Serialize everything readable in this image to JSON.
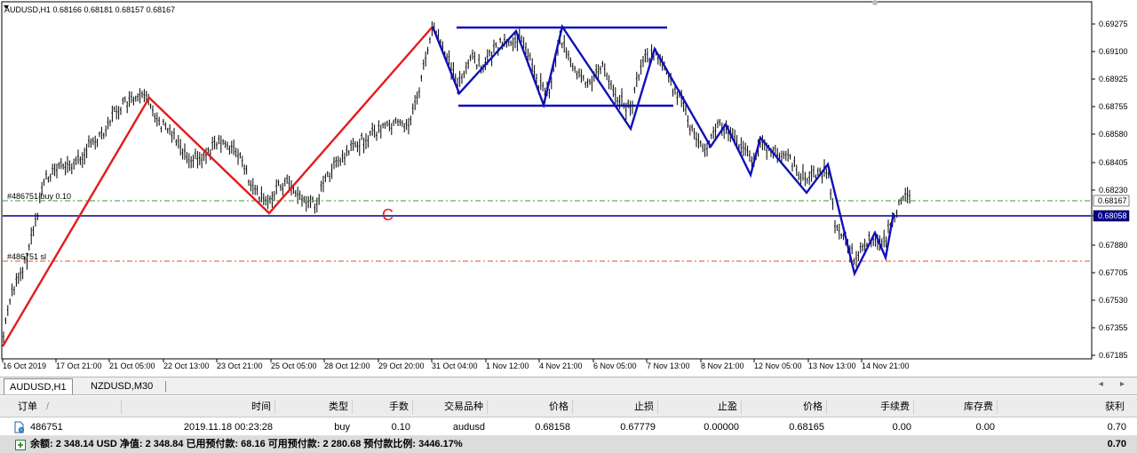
{
  "chart": {
    "symbol_info": "AUDUSD,H1  0.68166 0.68181 0.68157 0.68167",
    "price_axis_labels": [
      "0.69275",
      "0.69100",
      "0.68925",
      "0.68755",
      "0.68580",
      "0.68405",
      "0.68230",
      "0.68058",
      "0.67880",
      "0.67705",
      "0.67530",
      "0.67355",
      "0.67185"
    ],
    "current_price_tag": "0.68167",
    "line_price_tag": "0.68058",
    "time_axis_labels": [
      "16 Oct 2019",
      "17 Oct 21:00",
      "21 Oct 05:00",
      "22 Oct 13:00",
      "23 Oct 21:00",
      "25 Oct 05:00",
      "28 Oct 12:00",
      "29 Oct 20:00",
      "31 Oct 04:00",
      "1 Nov 12:00",
      "4 Nov 21:00",
      "6 Nov 05:00",
      "7 Nov 13:00",
      "8 Nov 21:00",
      "12 Nov 05:00",
      "13 Nov 13:00",
      "14 Nov 21:00"
    ],
    "order_tp_label": "#486751 buy 0.10",
    "order_sl_label": "#486751 sl",
    "annotation_c": "C",
    "colors": {
      "zigzag_red": "#e31b1b",
      "zigzag_blue": "#1010b8",
      "hline": "#00008b",
      "entry_dash": "#3a9a3a",
      "sl_dash": "#e05020",
      "bars": "#000000"
    }
  },
  "tabs": [
    {
      "label": "AUDUSD,H1",
      "active": true
    },
    {
      "label": "NZDUSD,M30",
      "active": false
    }
  ],
  "scroll_arrows": "◂ ▸",
  "table": {
    "headers": {
      "order": "订单",
      "sort": "/",
      "time": "时间",
      "type": "类型",
      "lots": "手数",
      "symbol": "交易品种",
      "price": "价格",
      "sl": "止损",
      "tp": "止盈",
      "cur_price": "价格",
      "commission": "手续费",
      "swap": "库存费",
      "profit": "获利"
    },
    "row": {
      "order": "486751",
      "time": "2019.11.18 00:23:28",
      "type": "buy",
      "lots": "0.10",
      "symbol": "audusd",
      "price": "0.68158",
      "sl": "0.67779",
      "tp": "0.00000",
      "cur_price": "0.68165",
      "commission": "0.00",
      "swap": "0.00",
      "profit": "0.70"
    },
    "summary": {
      "text": "余额: 2 348.14 USD  净值: 2 348.84  已用预付款: 68.16  可用预付款: 2 280.68  预付款比例: 3446.17%",
      "profit": "0.70"
    }
  }
}
